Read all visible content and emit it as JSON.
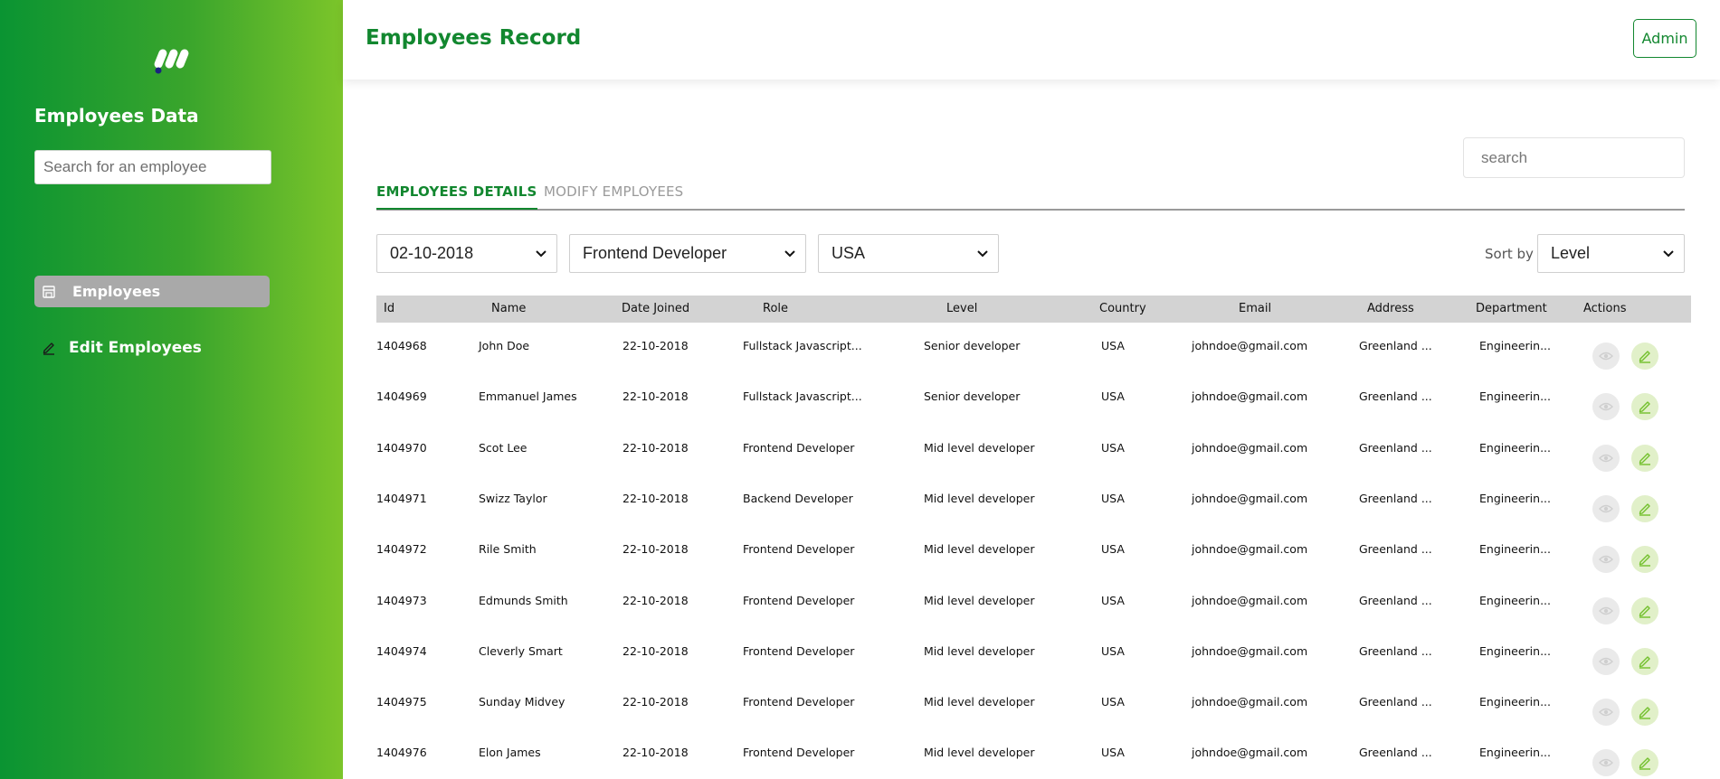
{
  "sidebar": {
    "title": "Employees Data",
    "search_placeholder": "Search for an employee",
    "nav": [
      {
        "label": "Employees",
        "icon": "store-icon",
        "active": true
      },
      {
        "label": "Edit Employees",
        "icon": "pencil-icon",
        "active": false
      }
    ]
  },
  "header": {
    "title": "Employees Record",
    "admin_label": "Admin"
  },
  "main": {
    "search_placeholder": "search",
    "tabs": [
      {
        "label": "EMPLOYEES DETAILS",
        "active": true
      },
      {
        "label": "MODIFY EMPLOYEES",
        "active": false
      }
    ],
    "filters": {
      "date": "02-10-2018",
      "role": "Frontend Developer",
      "country": "USA"
    },
    "sort": {
      "label": "Sort by",
      "value": "Level"
    },
    "table": {
      "columns": [
        "Id",
        "Name",
        "Date Joined",
        "Role",
        "Level",
        "Country",
        "Email",
        "Address",
        "Department",
        "Actions"
      ],
      "rows": [
        [
          "1404968",
          "John Doe",
          "22-10-2018",
          "Fullstack Javascript...",
          "Senior developer",
          "USA",
          "johndoe@gmail.com",
          "Greenland ...",
          "Engineerin..."
        ],
        [
          "1404969",
          "Emmanuel James",
          "22-10-2018",
          "Fullstack Javascript...",
          "Senior developer",
          "USA",
          "johndoe@gmail.com",
          "Greenland ...",
          "Engineerin..."
        ],
        [
          "1404970",
          "Scot Lee",
          "22-10-2018",
          "Frontend Developer",
          "Mid level developer",
          "USA",
          "johndoe@gmail.com",
          "Greenland ...",
          "Engineerin..."
        ],
        [
          "1404971",
          "Swizz Taylor",
          "22-10-2018",
          "Backend Developer",
          "Mid level developer",
          "USA",
          "johndoe@gmail.com",
          "Greenland ...",
          "Engineerin..."
        ],
        [
          "1404972",
          "Rile Smith",
          "22-10-2018",
          "Frontend Developer",
          "Mid level developer",
          "USA",
          "johndoe@gmail.com",
          "Greenland ...",
          "Engineerin..."
        ],
        [
          "1404973",
          "Edmunds Smith",
          "22-10-2018",
          "Frontend Developer",
          "Mid level developer",
          "USA",
          "johndoe@gmail.com",
          "Greenland ...",
          "Engineerin..."
        ],
        [
          "1404974",
          "Cleverly Smart",
          "22-10-2018",
          "Frontend Developer",
          "Mid level developer",
          "USA",
          "johndoe@gmail.com",
          "Greenland ...",
          "Engineerin..."
        ],
        [
          "1404975",
          "Sunday Midvey",
          "22-10-2018",
          "Frontend Developer",
          "Mid level developer",
          "USA",
          "johndoe@gmail.com",
          "Greenland ...",
          "Engineerin..."
        ],
        [
          "1404976",
          "Elon James",
          "22-10-2018",
          "Frontend Developer",
          "Mid level developer",
          "USA",
          "johndoe@gmail.com",
          "Greenland ...",
          "Engineerin..."
        ]
      ],
      "actions": [
        "eye-icon",
        "pencil-icon"
      ]
    }
  },
  "colors": {
    "brand_green": "#12872f",
    "sidebar_gradient_start": "#0a9432",
    "sidebar_gradient_end": "#7cc52a",
    "table_header_bg": "#d3d3d3",
    "nav_active_bg": "#a9a9a9"
  }
}
